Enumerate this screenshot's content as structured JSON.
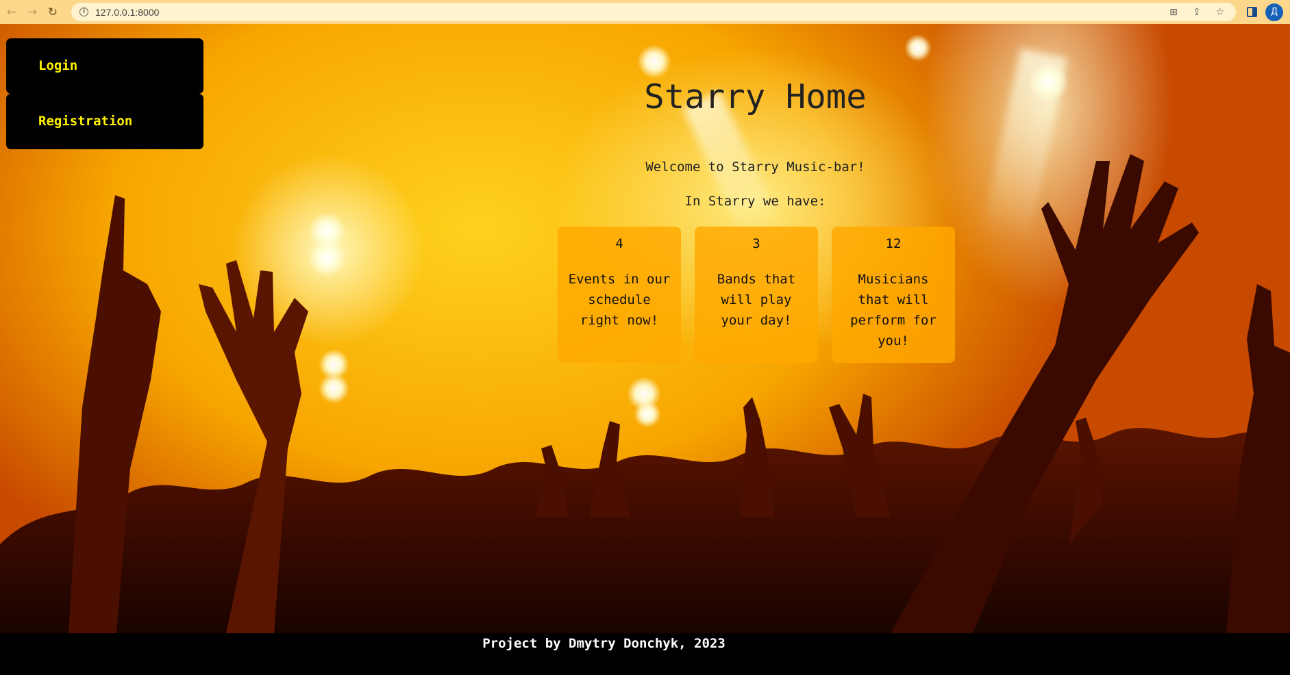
{
  "browser": {
    "back_icon": "arrow-left-icon",
    "forward_icon": "arrow-right-icon",
    "reload_icon": "reload-icon",
    "site_info_icon": "info-icon",
    "url": "127.0.0.1:8000",
    "translate_icon": "translate-icon",
    "share_icon": "share-icon",
    "bookmark_icon": "star-icon",
    "sidepanel_icon": "side-panel-icon",
    "profile_initial": "Д"
  },
  "auth_menu": {
    "login_label": "Login",
    "registration_label": "Registration"
  },
  "main": {
    "title": "Starry Home",
    "welcome": "Welcome to Starry Music-bar!",
    "intro": "In Starry we have:",
    "stats": [
      {
        "number": "4",
        "label": "Events in our schedule right now!"
      },
      {
        "number": "3",
        "label": "Bands that will play your day!"
      },
      {
        "number": "12",
        "label": "Musicians that will perform for you!"
      }
    ]
  },
  "footer": {
    "text": "Project by Dmytry Donchyk, 2023"
  },
  "colors": {
    "chrome_bar": "#fcd78c",
    "menu_bg": "#000000",
    "menu_text": "#fff200",
    "card_bg": "#ffa800",
    "footer_bg": "#000000",
    "footer_text": "#ffffff"
  }
}
